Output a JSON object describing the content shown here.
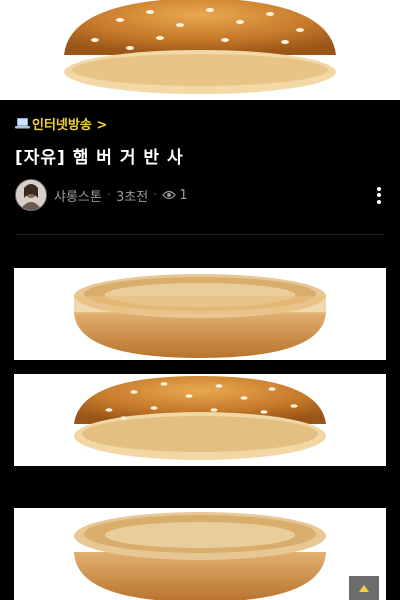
{
  "board": {
    "name": "인터넷방송 >",
    "icon": "laptop-icon"
  },
  "post": {
    "title": "[자유] 햄 버 거 반 사",
    "author": "샤롱스톤",
    "time": "3초전",
    "views": "1"
  },
  "images": [
    {
      "kind": "bun-bottom-half",
      "description_icon": "bun-bottom-icon"
    },
    {
      "kind": "bun-top-half",
      "description_icon": "bun-top-icon"
    },
    {
      "kind": "bun-bottom-half",
      "description_icon": "bun-bottom-icon"
    }
  ],
  "colors": {
    "board_link": "#f3d13b",
    "background": "#000000",
    "meta_text": "#9a9a9a"
  }
}
